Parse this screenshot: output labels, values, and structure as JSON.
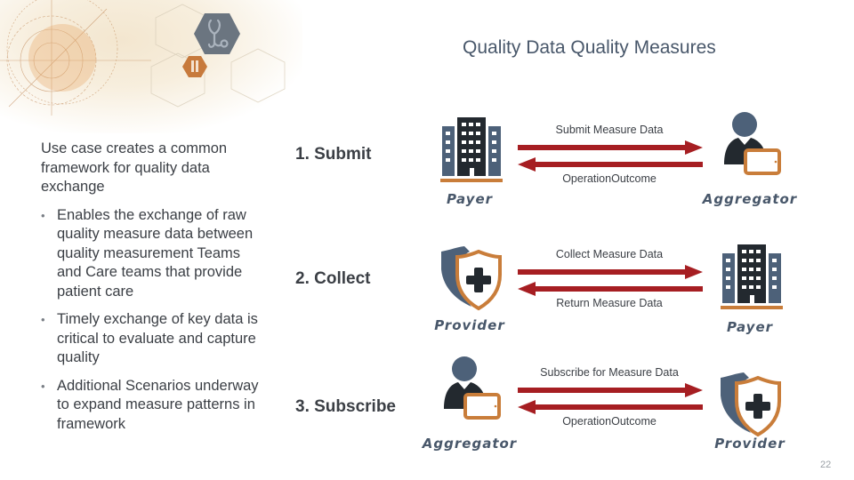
{
  "slide": {
    "title": "Quality Data Quality Measures",
    "page_number": "22"
  },
  "banner": {
    "icons": [
      "stethoscope-icon",
      "test-tube-icon"
    ]
  },
  "left_panel": {
    "intro": "Use case creates a common framework for quality data exchange",
    "bullets": [
      "Enables the exchange of raw quality measure data between quality measurement Teams and Care teams that provide patient care",
      "Timely exchange of key data is critical to evaluate and capture quality",
      "Additional Scenarios underway to expand measure patterns in framework"
    ],
    "bullet_glyph": "•"
  },
  "colors": {
    "arrow": "#a61e22",
    "dark": "#23292f",
    "slate": "#4d6179",
    "orange": "#c97d3a",
    "label": "#48576a"
  },
  "flows": [
    {
      "step": "1. Submit",
      "left_actor": {
        "name": "Payer",
        "icon": "building-icon"
      },
      "right_actor": {
        "name": "Aggregator",
        "icon": "person-tablet-icon"
      },
      "request": "Submit Measure Data",
      "response": "OperationOutcome"
    },
    {
      "step": "2. Collect",
      "left_actor": {
        "name": "Provider",
        "icon": "shield-cross-icon"
      },
      "right_actor": {
        "name": "Payer",
        "icon": "building-icon"
      },
      "request": "Collect Measure Data",
      "response": "Return Measure Data"
    },
    {
      "step": "3. Subscribe",
      "left_actor": {
        "name": "Aggregator",
        "icon": "person-tablet-icon"
      },
      "right_actor": {
        "name": "Provider",
        "icon": "shield-cross-icon"
      },
      "request": "Subscribe for Measure Data",
      "response": "OperationOutcome"
    }
  ]
}
